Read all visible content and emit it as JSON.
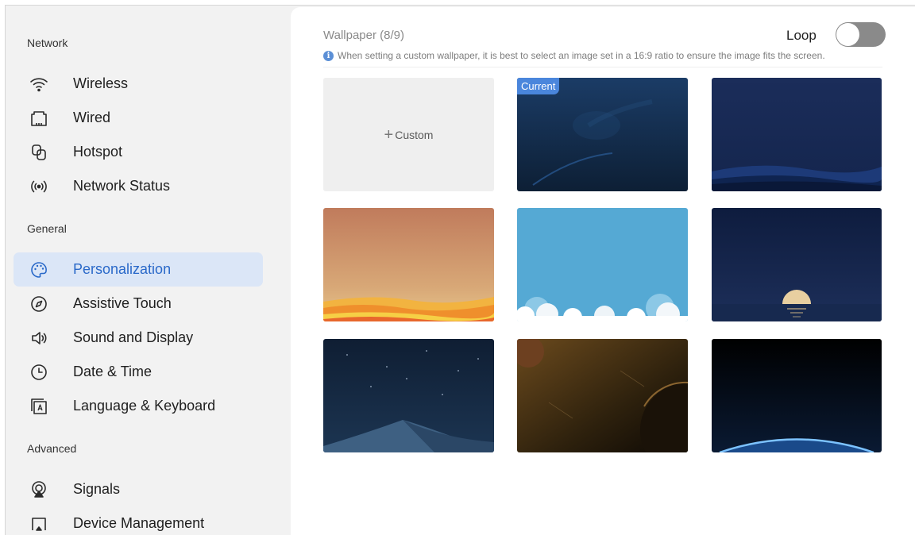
{
  "sidebar": {
    "sections": [
      {
        "title": "Network"
      },
      {
        "title": "General"
      },
      {
        "title": "Advanced"
      }
    ],
    "items": [
      {
        "label": "Wireless",
        "icon": "wifi-icon"
      },
      {
        "label": "Wired",
        "icon": "ethernet-icon"
      },
      {
        "label": "Hotspot",
        "icon": "hotspot-icon"
      },
      {
        "label": "Network Status",
        "icon": "network-status-icon"
      },
      {
        "label": "Personalization",
        "icon": "palette-icon",
        "active": true
      },
      {
        "label": "Assistive Touch",
        "icon": "compass-icon"
      },
      {
        "label": "Sound and Display",
        "icon": "speaker-icon"
      },
      {
        "label": "Date & Time",
        "icon": "clock-icon"
      },
      {
        "label": "Language & Keyboard",
        "icon": "language-keyboard-icon"
      },
      {
        "label": "Signals",
        "icon": "signal-source-icon"
      },
      {
        "label": "Device Management",
        "icon": "device-management-icon"
      }
    ]
  },
  "wallpaper": {
    "title": "Wallpaper (8/9)",
    "hint": "When setting a custom wallpaper, it is best to select an image set in a 16:9 ratio to ensure the image fits the screen.",
    "loop_label": "Loop",
    "loop_enabled": false,
    "custom_label": "Custom",
    "current_label": "Current",
    "tiles": [
      {
        "name": "custom"
      },
      {
        "name": "blue-abstract",
        "current": true
      },
      {
        "name": "night-dunes"
      },
      {
        "name": "orange-desert"
      },
      {
        "name": "sky-clouds"
      },
      {
        "name": "moonrise-sea"
      },
      {
        "name": "starry-desert"
      },
      {
        "name": "brown-planets"
      },
      {
        "name": "earth-horizon"
      }
    ]
  },
  "colors": {
    "accent": "#2a69c9",
    "active_bg": "#dbe6f7",
    "sidebar_bg": "#f2f2f2",
    "badge": "#4a86dc"
  }
}
